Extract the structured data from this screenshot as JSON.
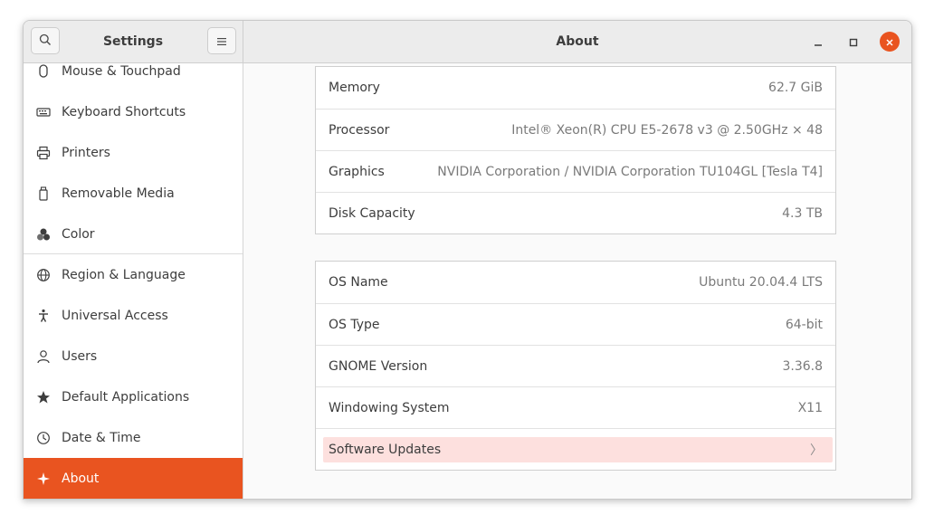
{
  "header": {
    "settings_title": "Settings",
    "page_title": "About"
  },
  "sidebar": {
    "items": [
      {
        "label": "Mouse & Touchpad",
        "icon": "mouse-icon"
      },
      {
        "label": "Keyboard Shortcuts",
        "icon": "keyboard-icon"
      },
      {
        "label": "Printers",
        "icon": "printer-icon"
      },
      {
        "label": "Removable Media",
        "icon": "usb-drive-icon"
      },
      {
        "label": "Color",
        "icon": "color-palette-icon"
      },
      {
        "label": "Region & Language",
        "icon": "globe-icon"
      },
      {
        "label": "Universal Access",
        "icon": "accessibility-icon"
      },
      {
        "label": "Users",
        "icon": "user-icon"
      },
      {
        "label": "Default Applications",
        "icon": "star-icon"
      },
      {
        "label": "Date & Time",
        "icon": "clock-icon"
      },
      {
        "label": "About",
        "icon": "sparkle-icon",
        "active": true
      }
    ]
  },
  "hardware": [
    {
      "label": "Memory",
      "value": "62.7 GiB"
    },
    {
      "label": "Processor",
      "value": "Intel® Xeon(R) CPU E5-2678 v3 @ 2.50GHz × 48"
    },
    {
      "label": "Graphics",
      "value": "NVIDIA Corporation / NVIDIA Corporation TU104GL [Tesla T4]"
    },
    {
      "label": "Disk Capacity",
      "value": "4.3 TB"
    }
  ],
  "software": [
    {
      "label": "OS Name",
      "value": "Ubuntu 20.04.4 LTS"
    },
    {
      "label": "OS Type",
      "value": "64-bit"
    },
    {
      "label": "GNOME Version",
      "value": "3.36.8"
    },
    {
      "label": "Windowing System",
      "value": "X11"
    }
  ],
  "software_updates": {
    "label": "Software Updates",
    "chevron": "〉"
  },
  "colors": {
    "accent": "#e95420",
    "highlight": "#fde0de"
  }
}
